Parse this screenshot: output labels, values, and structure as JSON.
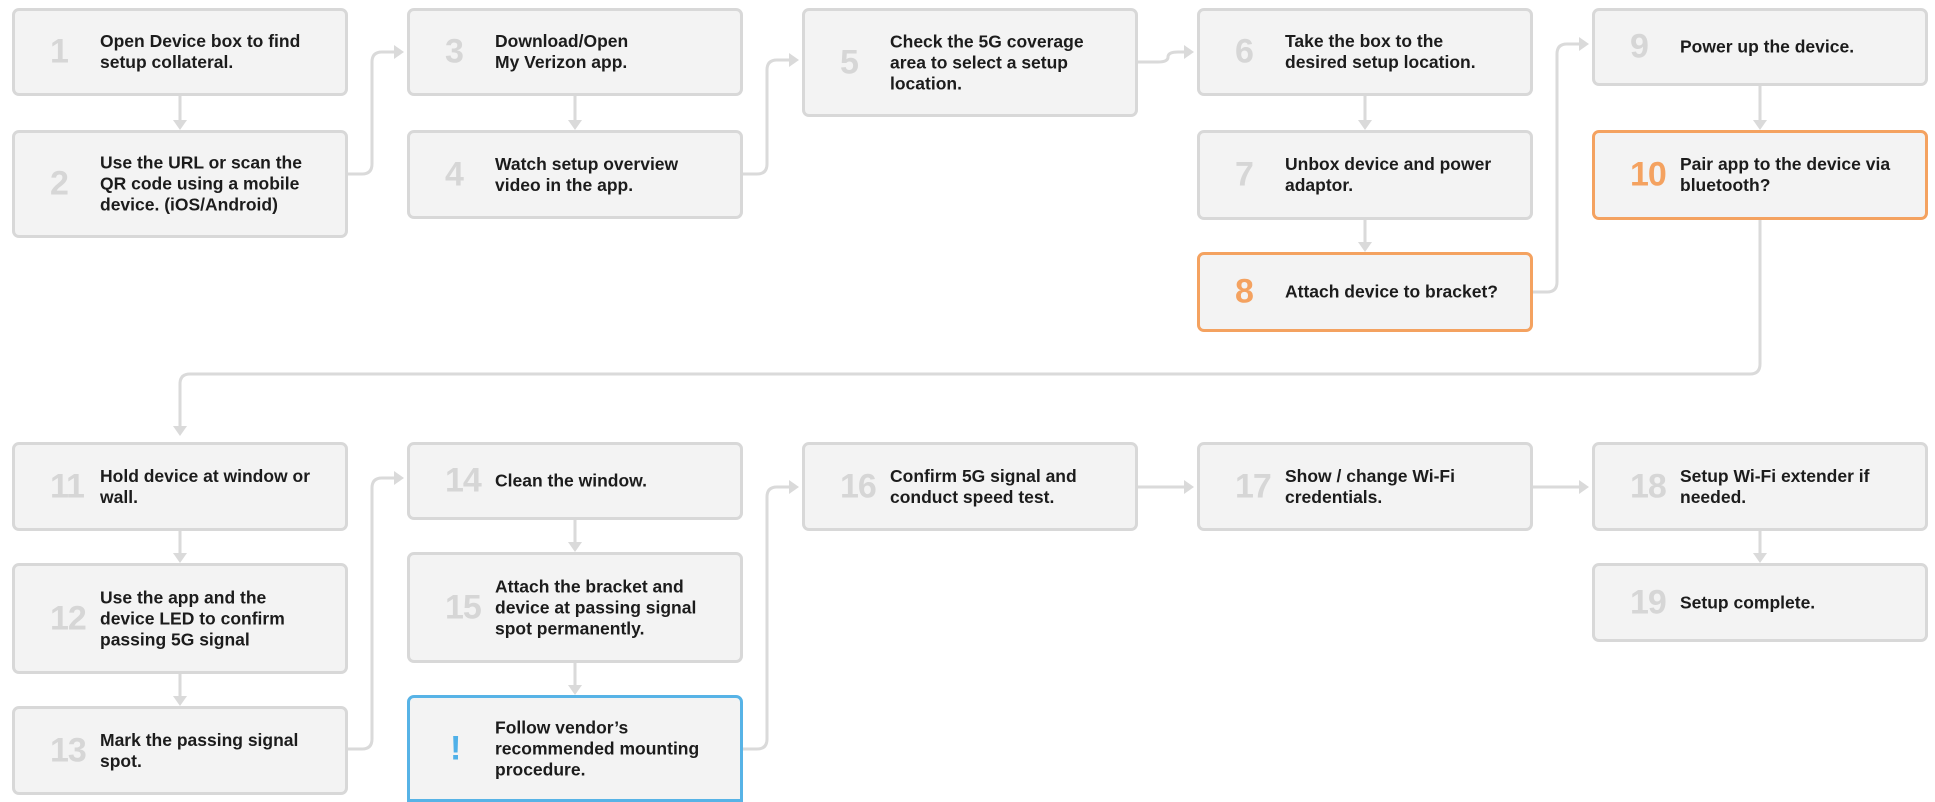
{
  "steps": [
    {
      "num": "1",
      "text": "Open Device box to find\nsetup collateral.",
      "highlight": "none"
    },
    {
      "num": "2",
      "text": "Use the URL or scan the\nQR code using a mobile\ndevice. (iOS/Android)",
      "highlight": "none"
    },
    {
      "num": "3",
      "text": "Download/Open\nMy Verizon app.",
      "highlight": "none"
    },
    {
      "num": "4",
      "text": "Watch setup overview\nvideo in the app.",
      "highlight": "none"
    },
    {
      "num": "5",
      "text": "Check the 5G coverage\narea to select a setup\nlocation.",
      "highlight": "none"
    },
    {
      "num": "6",
      "text": "Take the box to the\ndesired setup location.",
      "highlight": "none"
    },
    {
      "num": "7",
      "text": "Unbox device and power\nadaptor.",
      "highlight": "none"
    },
    {
      "num": "8",
      "text": "Attach device to bracket?",
      "highlight": "orange"
    },
    {
      "num": "9",
      "text": "Power up the device.",
      "highlight": "none"
    },
    {
      "num": "10",
      "text": "Pair app to the device via\nbluetooth?",
      "highlight": "orange"
    },
    {
      "num": "11",
      "text": "Hold device at window or\nwall.",
      "highlight": "none"
    },
    {
      "num": "12",
      "text": "Use the app and the\ndevice LED to confirm\npassing 5G signal",
      "highlight": "none"
    },
    {
      "num": "13",
      "text": "Mark the passing signal\nspot.",
      "highlight": "none"
    },
    {
      "num": "14",
      "text": "Clean the window.",
      "highlight": "none"
    },
    {
      "num": "15",
      "text": "Attach the bracket and\ndevice at passing signal\nspot permanently.",
      "highlight": "none"
    },
    {
      "num": "!",
      "text": "Follow vendor’s\nrecommended mounting\nprocedure.",
      "highlight": "blue"
    },
    {
      "num": "16",
      "text": "Confirm 5G signal and\nconduct speed test.",
      "highlight": "none"
    },
    {
      "num": "17",
      "text": "Show / change Wi-Fi\ncredentials.",
      "highlight": "none"
    },
    {
      "num": "18",
      "text": "Setup Wi-Fi extender if\nneeded.",
      "highlight": "none"
    },
    {
      "num": "19",
      "text": "Setup complete.",
      "highlight": "none"
    }
  ],
  "colors": {
    "box_fill": "#f3f3f3",
    "box_border": "#d8d8d8",
    "number_gray": "#d6d6d6",
    "highlight_orange": "#f4a260",
    "highlight_blue": "#57b3e6",
    "connector": "#dadada",
    "text": "#1c1c1c"
  }
}
